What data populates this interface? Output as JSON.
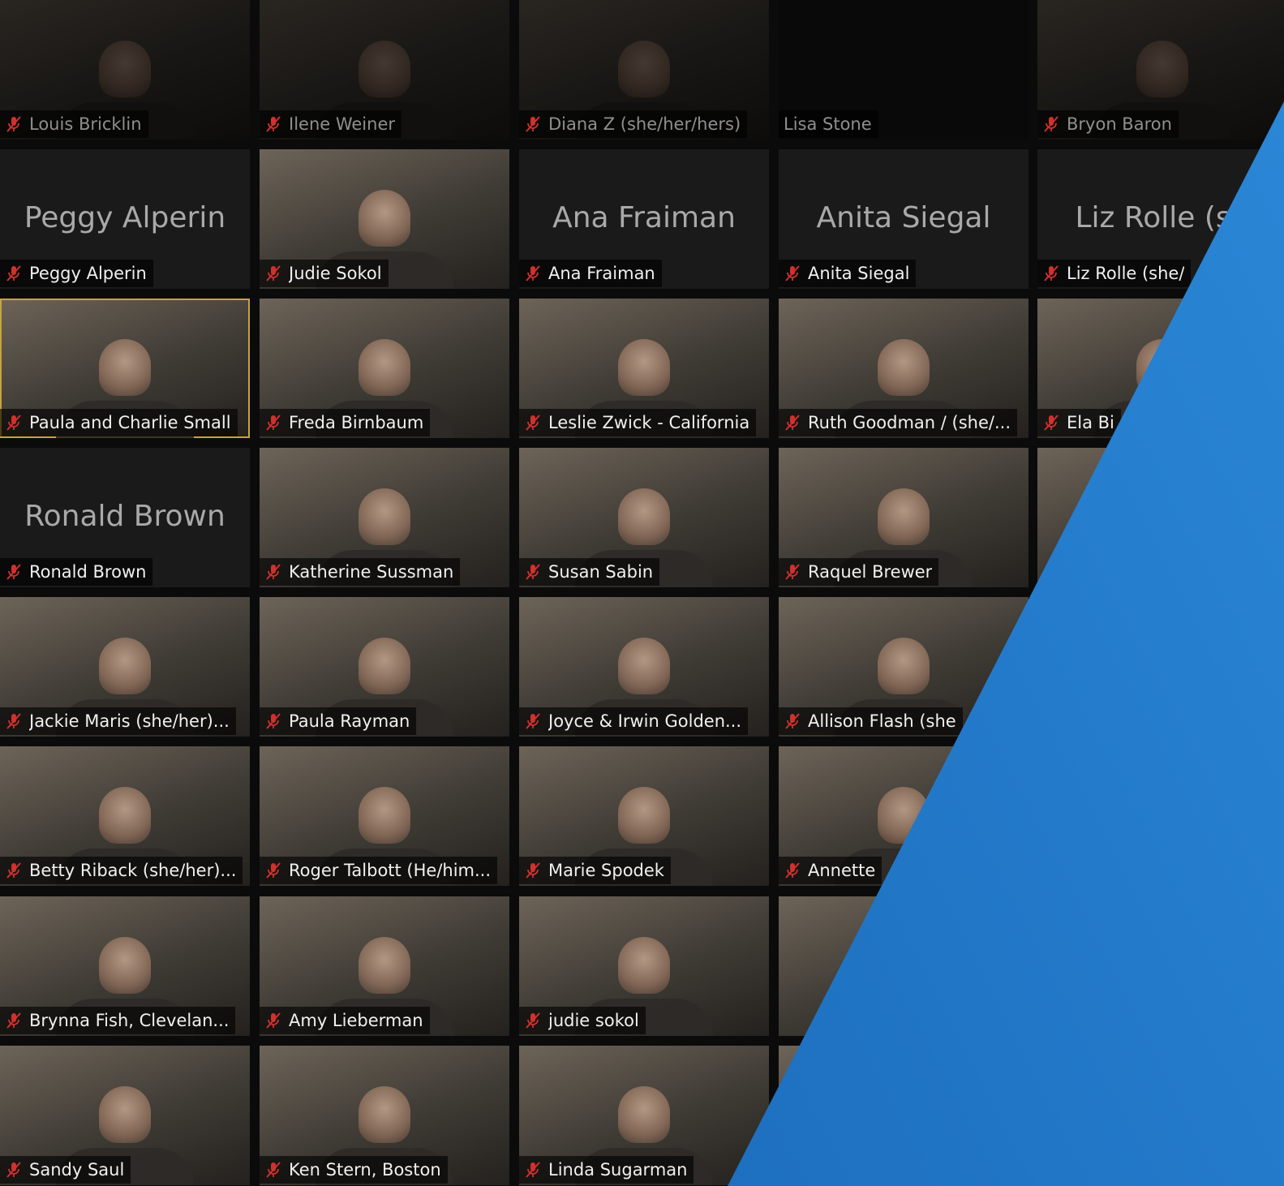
{
  "header": {
    "title_fragment": ""
  },
  "colors": {
    "accent_blue": "#2a86d6",
    "accent_blue_dark": "#1e6fbf",
    "muted_mic": "#d0312d",
    "active_speaker_border": "#c7a43b"
  },
  "participants": [
    {
      "name": "Louis Bricklin",
      "video": true,
      "dim": true
    },
    {
      "name": "Ilene Weiner",
      "video": true,
      "dim": true
    },
    {
      "name": "Diana Z (she/her/hers)",
      "video": true,
      "dim": true
    },
    {
      "name": "Lisa Stone",
      "video": false,
      "dim": true,
      "no_mic_icon": true
    },
    {
      "name": "Bryon Baron",
      "video": true,
      "dim": true
    },
    {
      "name": "Peggy Alperin",
      "video": false,
      "placeholder": "Peggy Alperin"
    },
    {
      "name": "Judie Sokol",
      "video": true
    },
    {
      "name": "Ana Fraiman",
      "video": false,
      "placeholder": "Ana Fraiman"
    },
    {
      "name": "Anita Siegal",
      "video": false,
      "placeholder": "Anita Siegal"
    },
    {
      "name": "Liz Rolle (she/",
      "video": false,
      "placeholder": "Liz Rolle (sh"
    },
    {
      "name": "Paula and Charlie Small",
      "video": true,
      "active": true
    },
    {
      "name": "Freda Birnbaum",
      "video": true
    },
    {
      "name": "Leslie Zwick - California",
      "video": true
    },
    {
      "name": "Ruth Goodman / (she/...",
      "video": true
    },
    {
      "name": "Ela Bi",
      "video": true
    },
    {
      "name": "Ronald Brown",
      "video": false,
      "placeholder": "Ronald Brown"
    },
    {
      "name": "Katherine Sussman",
      "video": true
    },
    {
      "name": "Susan Sabin",
      "video": true
    },
    {
      "name": "Raquel Brewer",
      "video": true
    },
    {
      "name": "",
      "video": true
    },
    {
      "name": "Jackie Maris (she/her)...",
      "video": true
    },
    {
      "name": "Paula Rayman",
      "video": true
    },
    {
      "name": "Joyce & Irwin Golden...",
      "video": true
    },
    {
      "name": "Allison Flash (she",
      "video": true
    },
    {
      "name": "",
      "video": true
    },
    {
      "name": "Betty Riback (she/her)...",
      "video": true
    },
    {
      "name": "Roger Talbott (He/him...",
      "video": true
    },
    {
      "name": "Marie Spodek",
      "video": true
    },
    {
      "name": "Annette",
      "video": true
    },
    {
      "name": "",
      "video": true
    },
    {
      "name": "Brynna Fish, Clevelan...",
      "video": true
    },
    {
      "name": "Amy Lieberman",
      "video": true
    },
    {
      "name": "judie sokol",
      "video": true
    },
    {
      "name": "",
      "video": true
    },
    {
      "name": "",
      "video": true
    },
    {
      "name": "Sandy Saul",
      "video": true
    },
    {
      "name": "Ken Stern, Boston",
      "video": true
    },
    {
      "name": "Linda Sugarman",
      "video": true
    },
    {
      "name": "",
      "video": true
    },
    {
      "name": "",
      "video": true
    }
  ]
}
